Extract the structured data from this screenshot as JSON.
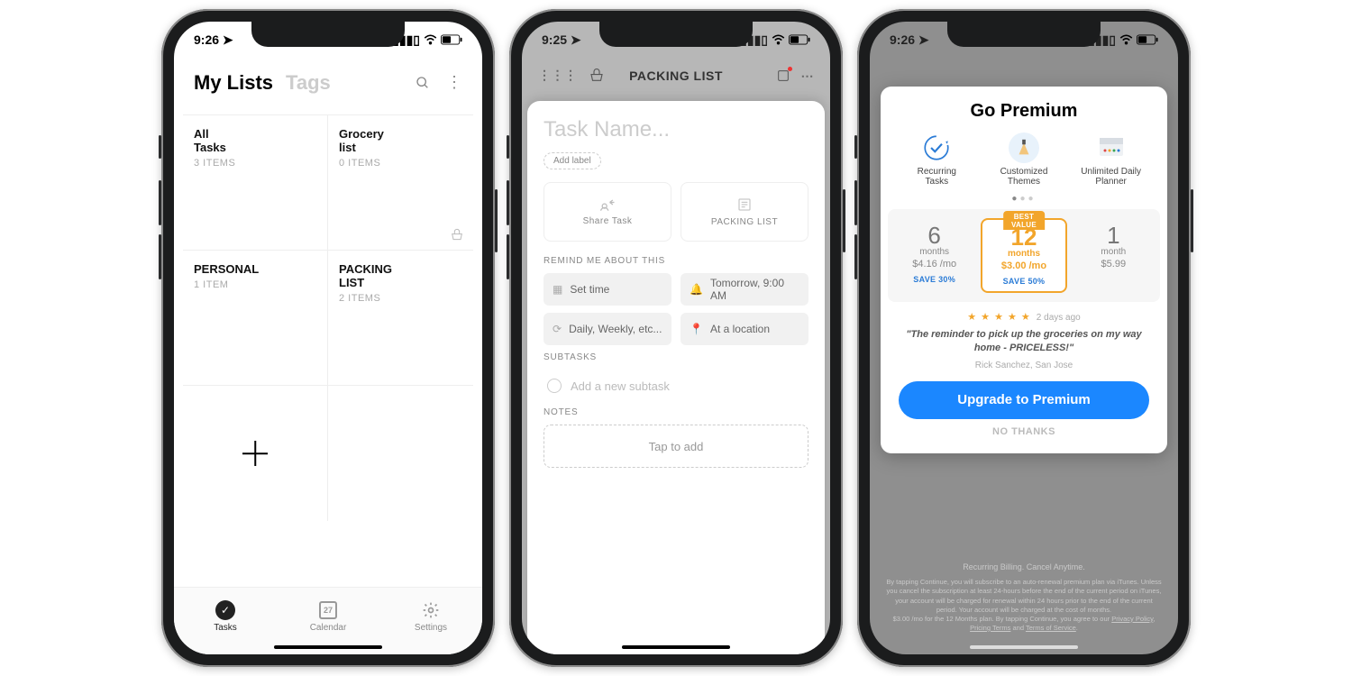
{
  "phone1": {
    "status_time": "9:26",
    "tabs": {
      "active": "My Lists",
      "inactive": "Tags"
    },
    "cells": [
      {
        "title": "All\nTasks",
        "sub": "3 ITEMS"
      },
      {
        "title": "Grocery\nlist",
        "sub": "0 ITEMS"
      },
      {
        "title": "PERSONAL",
        "sub": "1 ITEM"
      },
      {
        "title": "PACKING\nLIST",
        "sub": "2 ITEMS"
      }
    ],
    "tabbar": {
      "tasks": "Tasks",
      "calendar": "Calendar",
      "cal_day": "27",
      "settings": "Settings"
    }
  },
  "phone2": {
    "status_time": "9:25",
    "top_title": "PACKING LIST",
    "task_placeholder": "Task Name...",
    "add_label": "Add label",
    "share_task": "Share Task",
    "list_name": "PACKING LIST",
    "remind_label": "REMIND ME ABOUT THIS",
    "chips": {
      "set_time": "Set time",
      "tomorrow": "Tomorrow, 9:00 AM",
      "recur": "Daily, Weekly, etc...",
      "location": "At a location"
    },
    "subtasks_label": "SUBTASKS",
    "add_subtask": "Add a new subtask",
    "notes_label": "NOTES",
    "notes_placeholder": "Tap to add"
  },
  "phone3": {
    "status_time": "9:26",
    "title": "Go Premium",
    "features": [
      {
        "label": "Recurring\nTasks"
      },
      {
        "label": "Customized\nThemes"
      },
      {
        "label": "Unlimited Daily\nPlanner"
      }
    ],
    "plans": [
      {
        "n": "6",
        "unit": "months",
        "price": "$4.16 /mo",
        "save": "SAVE 30%"
      },
      {
        "n": "12",
        "unit": "months",
        "price": "$3.00 /mo",
        "save": "SAVE 50%",
        "best": "BEST VALUE"
      },
      {
        "n": "1",
        "unit": "month",
        "price": "$5.99",
        "save": ""
      }
    ],
    "review": {
      "ago": "2 days ago",
      "quote": "\"The reminder to pick up the groceries on my way home - PRICELESS!\"",
      "author": "Rick Sanchez, San Jose"
    },
    "cta": "Upgrade to Premium",
    "no_thanks": "NO THANKS",
    "legal_header": "Recurring Billing. Cancel Anytime.",
    "legal_body": "By tapping Continue, you will subscribe to an auto-renewal premium plan via iTunes. Unless you cancel the subscription at least 24-hours before the end of the current period on iTunes, your account will be charged for renewal within 24 hours prior to the end of the current period. Your account will be charged at the cost of months.",
    "legal_line2_a": "$3.00 /mo for the 12 Months plan. By tapping Continue, you agree to our ",
    "legal_privacy": "Privacy Policy",
    "legal_pricing": "Pricing Terms",
    "legal_and": " and ",
    "legal_tos": "Terms of Service"
  }
}
